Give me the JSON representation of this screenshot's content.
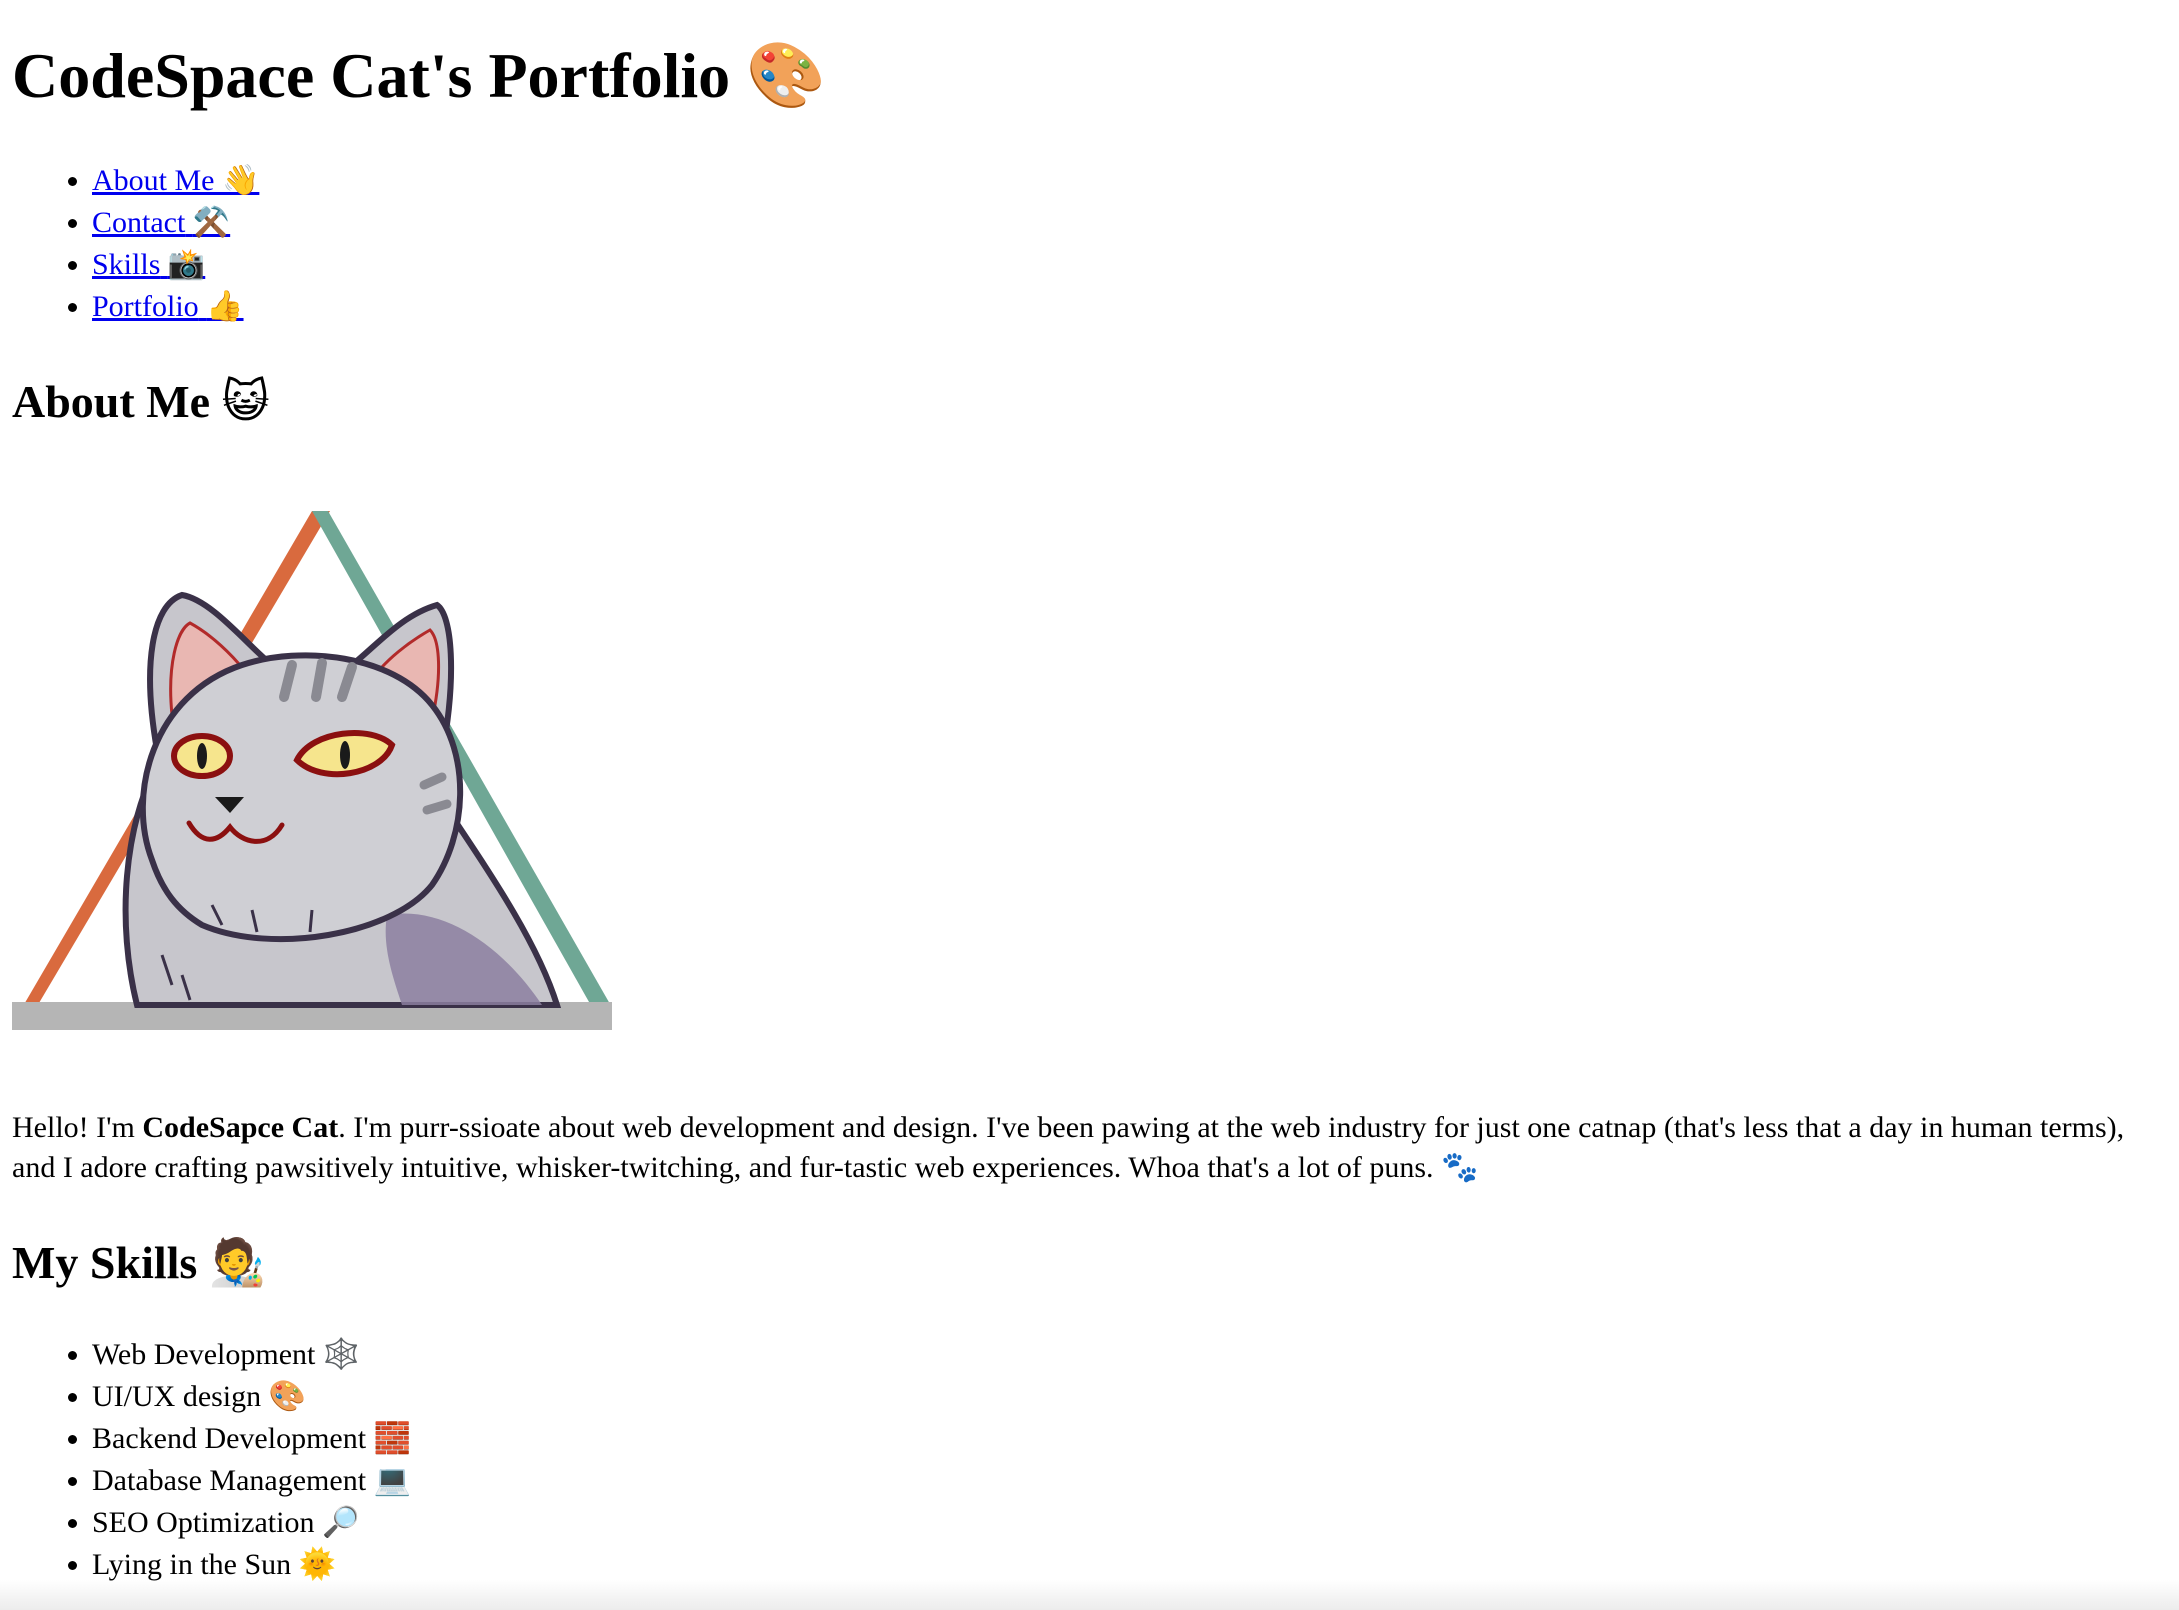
{
  "header": {
    "title": "CodeSpace Cat's Portfolio",
    "title_emoji": "🎨"
  },
  "nav": {
    "items": [
      {
        "label": "About Me",
        "emoji": "👋"
      },
      {
        "label": "Contact",
        "emoji": "⚒️"
      },
      {
        "label": "Skills",
        "emoji": "📸"
      },
      {
        "label": "Portfolio",
        "emoji": "👍"
      }
    ]
  },
  "about": {
    "heading": "About Me",
    "heading_emoji": "😺",
    "image_alt": "CodeSpace Cat",
    "bio_intro": "Hello! I'm ",
    "bio_name": "CodeSapce Cat",
    "bio_rest": ". I'm purr-ssioate about web development and design. I've been pawing at the web industry for just one catnap (that's less that a day in human terms), and I adore crafting pawsitively intuitive, whisker-twitching, and fur-tastic web experiences. Whoa that's a lot of puns. ",
    "bio_emoji": "🐾"
  },
  "skills": {
    "heading": "My Skills",
    "heading_emoji": "🧑‍🎨",
    "items": [
      {
        "label": "Web Development",
        "emoji": "🕸️"
      },
      {
        "label": "UI/UX design",
        "emoji": "🎨"
      },
      {
        "label": "Backend Development",
        "emoji": "🧱"
      },
      {
        "label": "Database Management",
        "emoji": "💻"
      },
      {
        "label": "SEO Optimization",
        "emoji": "🔎"
      },
      {
        "label": "Lying in the Sun",
        "emoji": "🌞"
      }
    ]
  },
  "colors": {
    "link": "#0000ee",
    "triangle_left": "#d96a3e",
    "triangle_right": "#6fa795",
    "triangle_base": "#b5b5b5",
    "cat_fur": "#c8c8cc",
    "cat_eyes": "#f6e58d"
  }
}
